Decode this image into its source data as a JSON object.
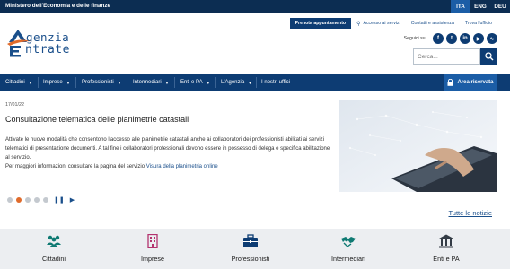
{
  "topbar": {
    "ministry": "Ministero dell'Economia e delle finanze",
    "languages": [
      "ITA",
      "ENG",
      "DEU"
    ],
    "active_language": "ITA"
  },
  "utility_links": [
    {
      "label": "Prenota appuntamento",
      "icon": "none"
    },
    {
      "label": "Accesso ai servizi",
      "icon": "key-icon"
    },
    {
      "label": "Contatti e assistenza",
      "icon": "none"
    },
    {
      "label": "Trova l'ufficio",
      "icon": "none"
    }
  ],
  "logo": {
    "line1": "genzia",
    "line2": "ntrate"
  },
  "social": {
    "label": "Seguici su:",
    "networks": [
      "facebook-icon",
      "twitter-icon",
      "linkedin-icon",
      "youtube-icon",
      "rss-icon"
    ]
  },
  "search": {
    "placeholder": "Cerca..."
  },
  "nav": {
    "items": [
      "Cittadini",
      "Imprese",
      "Professionisti",
      "Intermediari",
      "Enti e PA",
      "L'Agenzia",
      "I nostri uffici"
    ],
    "reserved": "Area riservata"
  },
  "news": {
    "date": "17/01/22",
    "title": "Consultazione telematica delle planimetrie catastali",
    "body": "Attivate le nuove modalità che consentono l'accesso alle planimetrie catastali anche ai collaboratori dei professionisti abilitati ai servizi telematici di presentazione documenti. A tal fine i collaboratori professionali devono essere in possesso di delega e specifica abilitazione al servizio.",
    "more_prefix": "Per maggiori informazioni consultare la pagina del servizio",
    "more_link": "Visura della planimetria online",
    "all_news": "Tutte le notizie"
  },
  "carousel": {
    "slide_count": 5,
    "active_slide": 2
  },
  "categories": [
    {
      "label": "Cittadini",
      "icon": "people-icon"
    },
    {
      "label": "Imprese",
      "icon": "building-icon"
    },
    {
      "label": "Professionisti",
      "icon": "briefcase-icon"
    },
    {
      "label": "Intermediari",
      "icon": "handshake-icon"
    },
    {
      "label": "Enti e PA",
      "icon": "institution-icon"
    }
  ],
  "colors": {
    "navy": "#0d3c73",
    "blue": "#1b5da6",
    "accent": "#e06b2b",
    "teal": "#0f7a73",
    "magenta": "#b3326e"
  }
}
